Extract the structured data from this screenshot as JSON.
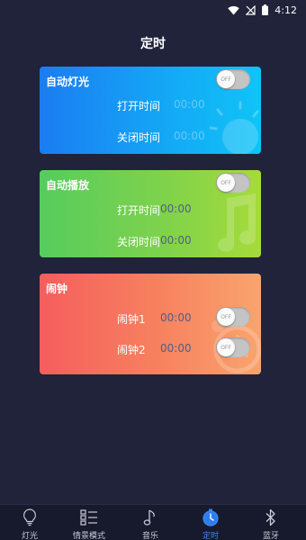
{
  "status_bar": {
    "time": "4:12"
  },
  "page": {
    "title": "定时"
  },
  "cards": {
    "auto_light": {
      "title": "自动灯光",
      "toggle": "OFF",
      "rows": [
        {
          "label": "打开时间",
          "time": "00:00"
        },
        {
          "label": "关闭时间",
          "time": "00:00"
        }
      ]
    },
    "auto_play": {
      "title": "自动播放",
      "toggle": "OFF",
      "rows": [
        {
          "label": "打开时间",
          "time": "00:00"
        },
        {
          "label": "关闭时间",
          "time": "00:00"
        }
      ]
    },
    "alarm": {
      "title": "闹钟",
      "rows": [
        {
          "label": "闹钟1",
          "time": "00:00",
          "toggle": "OFF"
        },
        {
          "label": "闹钟2",
          "time": "00:00",
          "toggle": "OFF"
        }
      ]
    }
  },
  "nav": {
    "items": [
      {
        "label": "灯光",
        "icon": "bulb-icon"
      },
      {
        "label": "情景模式",
        "icon": "scene-list-icon"
      },
      {
        "label": "音乐",
        "icon": "music-note-icon"
      },
      {
        "label": "定时",
        "icon": "timer-icon",
        "active": true
      },
      {
        "label": "蓝牙",
        "icon": "bluetooth-icon"
      }
    ]
  },
  "colors": {
    "background": "#20233a",
    "nav_active": "#3b8af7",
    "card_blue": "#1b7cf2",
    "card_green": "#55cc5e",
    "card_red": "#f55e5e"
  }
}
